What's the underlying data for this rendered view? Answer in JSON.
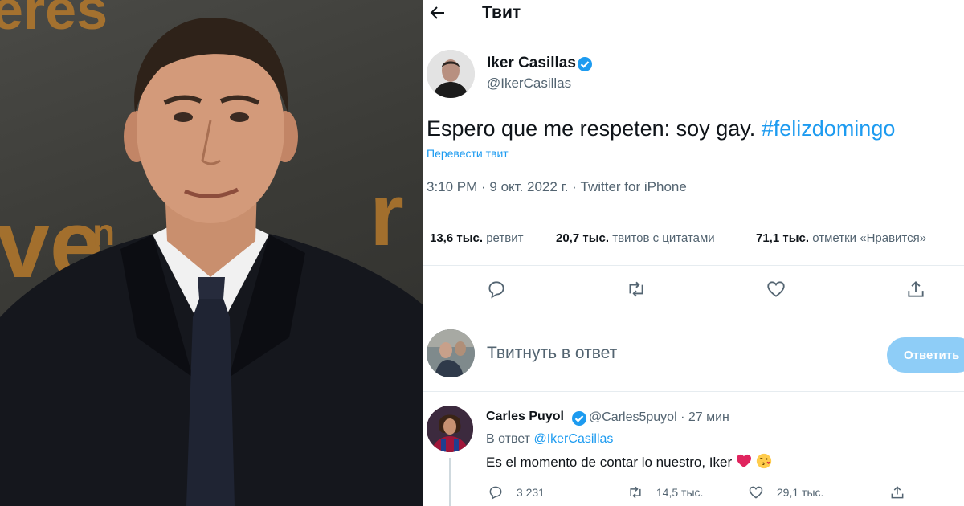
{
  "header": {
    "title": "Твит",
    "back_icon": "arrow-left-icon"
  },
  "tweet": {
    "author_name": "Iker Casillas",
    "author_handle": "@IkerCasillas",
    "verified": true,
    "text": "Espero que me respeten: soy gay.",
    "hashtag": "#felizdomingo",
    "translate_label": "Перевести твит",
    "timestamp": "3:10 PM · 9 окт. 2022 г. · Twitter for iPhone"
  },
  "stats": {
    "retweets_value": "13,6 тыс.",
    "retweets_label": "ретвит",
    "quotes_value": "20,7 тыс.",
    "quotes_label": "твитов с цитатами",
    "likes_value": "71,1 тыс.",
    "likes_label": "отметки «Нравится»"
  },
  "actions": [
    "reply-icon",
    "retweet-icon",
    "heart-icon",
    "share-icon"
  ],
  "compose": {
    "placeholder": "Твитнуть в ответ",
    "button_label": "Ответить"
  },
  "reply": {
    "author_name": "Carles Puyol",
    "author_handle": "@Carles5puyol",
    "time": "· 27 мин",
    "reply_to_prefix": "В ответ",
    "reply_to_handle": "@IkerCasillas",
    "text": "Es el momento de contar lo nuestro, Iker",
    "emojis": [
      "red-heart-emoji",
      "face-blowing-kiss-emoji"
    ],
    "reply_count": "3 231",
    "retweet_count": "14,5 тыс.",
    "like_count": "29,1 тыс."
  },
  "colors": {
    "accent": "#1d9bf0",
    "secondary_text": "#536471",
    "button_disabled": "#8ecdf7",
    "heart": "#e0245e"
  }
}
